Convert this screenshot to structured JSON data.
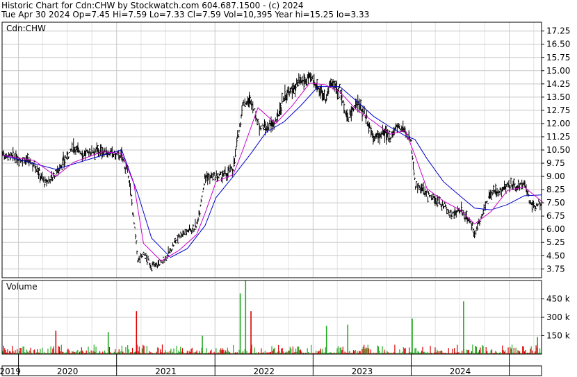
{
  "header": {
    "title": "Historic Chart for Cdn:CHW by Stockwatch.com 604.687.1500 - (c) 2024",
    "quote": "Tue Apr 30 2024   Op=7.45   Hi=7.59   Lo=7.33   Cl=7.59   Vol=10,395   Year hi=15.25   lo=3.33"
  },
  "chart_data": [
    {
      "type": "line",
      "title": "Cdn:CHW",
      "xlabel": "",
      "ylabel": "",
      "ylim": [
        3.25,
        17.75
      ],
      "yticks": [
        "17.25",
        "16.50",
        "15.75",
        "15.00",
        "14.25",
        "13.50",
        "12.75",
        "12.00",
        "11.25",
        "10.50",
        "9.75",
        "9.00",
        "8.25",
        "7.50",
        "6.75",
        "6.00",
        "5.25",
        "4.50",
        "3.75"
      ],
      "x_axis": {
        "type": "date",
        "start": "2018-11-01",
        "end": "2024-04-30",
        "labels": [
          "2019",
          "2020",
          "2021",
          "2022",
          "2023",
          "2024"
        ]
      },
      "grid": true,
      "colors": {
        "price": "#000000",
        "ma_fast": "#cc00cc",
        "ma_slow": "#0000cc",
        "grid": "#c8c8c8"
      },
      "series": [
        {
          "role": "price",
          "x": [
            "2018-11-01",
            "2018-12-15",
            "2019-01-20",
            "2019-03-01",
            "2019-04-10",
            "2019-05-20",
            "2019-06-20",
            "2019-07-25",
            "2019-09-01",
            "2019-10-10",
            "2019-11-10",
            "2019-12-10",
            "2020-01-20",
            "2020-02-15",
            "2020-03-05",
            "2020-03-20",
            "2020-04-10",
            "2020-05-10",
            "2020-06-15",
            "2020-07-20",
            "2020-08-20",
            "2020-09-20",
            "2020-10-25",
            "2020-11-25",
            "2021-01-05",
            "2021-02-10",
            "2021-03-10",
            "2021-04-15",
            "2021-05-15",
            "2021-06-10",
            "2021-07-10",
            "2021-08-15",
            "2021-09-15",
            "2021-10-15",
            "2021-11-15",
            "2021-12-20",
            "2022-01-20",
            "2022-02-15",
            "2022-03-10",
            "2022-04-10",
            "2022-05-10",
            "2022-06-10",
            "2022-07-10",
            "2022-08-15",
            "2022-09-15",
            "2022-10-15",
            "2022-11-15",
            "2022-12-10",
            "2023-01-01",
            "2023-01-15",
            "2023-02-01",
            "2023-03-01",
            "2023-04-01",
            "2023-05-01",
            "2023-06-01",
            "2023-07-01",
            "2023-08-01",
            "2023-08-25",
            "2023-09-25",
            "2023-10-25",
            "2023-11-25",
            "2023-12-25",
            "2024-01-25",
            "2024-02-25",
            "2024-03-25",
            "2024-04-30"
          ],
          "values": [
            10.3,
            10.05,
            9.95,
            9.7,
            8.6,
            9.2,
            9.9,
            10.7,
            10.25,
            10.5,
            10.4,
            10.3,
            10.15,
            9.0,
            6.5,
            4.2,
            4.6,
            3.9,
            4.1,
            4.8,
            5.7,
            5.9,
            6.2,
            9.0,
            8.9,
            9.1,
            9.5,
            13.1,
            13.3,
            12.0,
            11.7,
            12.1,
            13.5,
            13.9,
            14.3,
            14.6,
            14.1,
            13.4,
            14.3,
            13.9,
            12.2,
            13.2,
            12.6,
            11.2,
            11.4,
            11.3,
            11.9,
            11.6,
            10.9,
            8.6,
            8.3,
            8.0,
            7.6,
            7.4,
            6.8,
            7.1,
            6.6,
            5.7,
            7.0,
            8.0,
            8.2,
            8.5,
            8.4,
            8.5,
            7.3,
            7.59
          ]
        },
        {
          "role": "ma_fast",
          "x": [
            "2018-11-01",
            "2019-03-01",
            "2019-05-20",
            "2019-07-25",
            "2019-11-10",
            "2020-01-20",
            "2020-03-05",
            "2020-04-10",
            "2020-06-15",
            "2020-08-20",
            "2020-10-25",
            "2020-11-25",
            "2021-01-05",
            "2021-03-10",
            "2021-04-15",
            "2021-06-10",
            "2021-08-15",
            "2021-10-15",
            "2021-12-20",
            "2022-02-15",
            "2022-04-10",
            "2022-06-10",
            "2022-08-15",
            "2022-10-15",
            "2022-12-10",
            "2023-01-15",
            "2023-03-01",
            "2023-05-01",
            "2023-07-01",
            "2023-08-25",
            "2023-10-25",
            "2023-12-25",
            "2024-02-25",
            "2024-04-30"
          ],
          "values": [
            10.2,
            9.9,
            9.0,
            9.8,
            10.4,
            10.3,
            8.6,
            5.2,
            4.2,
            4.8,
            5.7,
            6.9,
            8.7,
            9.1,
            10.5,
            12.9,
            12.0,
            13.0,
            14.3,
            14.2,
            13.8,
            12.8,
            12.1,
            11.4,
            11.6,
            10.2,
            8.3,
            7.6,
            7.1,
            6.3,
            7.0,
            8.2,
            8.4,
            7.6
          ]
        },
        {
          "role": "ma_slow",
          "x": [
            "2018-11-01",
            "2019-05-20",
            "2019-11-10",
            "2020-01-20",
            "2020-03-20",
            "2020-05-10",
            "2020-07-20",
            "2020-09-20",
            "2020-11-25",
            "2021-01-05",
            "2021-03-10",
            "2021-05-15",
            "2021-07-10",
            "2021-09-15",
            "2021-11-15",
            "2022-01-20",
            "2022-04-10",
            "2022-06-10",
            "2022-08-15",
            "2022-10-15",
            "2022-12-10",
            "2023-01-15",
            "2023-03-01",
            "2023-05-01",
            "2023-07-01",
            "2023-08-25",
            "2023-10-25",
            "2023-12-25",
            "2024-02-25",
            "2024-04-30"
          ],
          "values": [
            10.2,
            9.4,
            10.2,
            10.5,
            8.0,
            5.5,
            4.4,
            4.9,
            6.2,
            7.8,
            9.0,
            10.3,
            11.5,
            12.1,
            13.0,
            14.1,
            14.1,
            13.3,
            12.4,
            11.8,
            11.3,
            11.1,
            10.0,
            8.7,
            7.9,
            7.2,
            7.1,
            7.4,
            7.9,
            7.95
          ]
        }
      ]
    },
    {
      "type": "bar",
      "title": "Volume",
      "ylim": [
        0,
        600000
      ],
      "yticks": [
        "450 k",
        "300 k",
        "150 k"
      ],
      "x_axis": {
        "type": "date",
        "start": "2018-11-01",
        "end": "2024-04-30"
      },
      "colors": {
        "up": "#22aa22",
        "down": "#dd0000"
      },
      "spikes": [
        {
          "date": "2019-05-20",
          "value": 190000,
          "dir": "down"
        },
        {
          "date": "2019-12-01",
          "value": 180000,
          "dir": "up"
        },
        {
          "date": "2020-03-15",
          "value": 350000,
          "dir": "down"
        },
        {
          "date": "2020-11-15",
          "value": 150000,
          "dir": "up"
        },
        {
          "date": "2021-04-05",
          "value": 495000,
          "dir": "up"
        },
        {
          "date": "2021-04-25",
          "value": 600000,
          "dir": "up"
        },
        {
          "date": "2021-05-15",
          "value": 350000,
          "dir": "down"
        },
        {
          "date": "2022-02-20",
          "value": 230000,
          "dir": "up"
        },
        {
          "date": "2022-05-10",
          "value": 240000,
          "dir": "up"
        },
        {
          "date": "2023-01-05",
          "value": 290000,
          "dir": "up"
        },
        {
          "date": "2023-07-15",
          "value": 430000,
          "dir": "up"
        },
        {
          "date": "2024-04-15",
          "value": 140000,
          "dir": "up"
        }
      ]
    }
  ]
}
